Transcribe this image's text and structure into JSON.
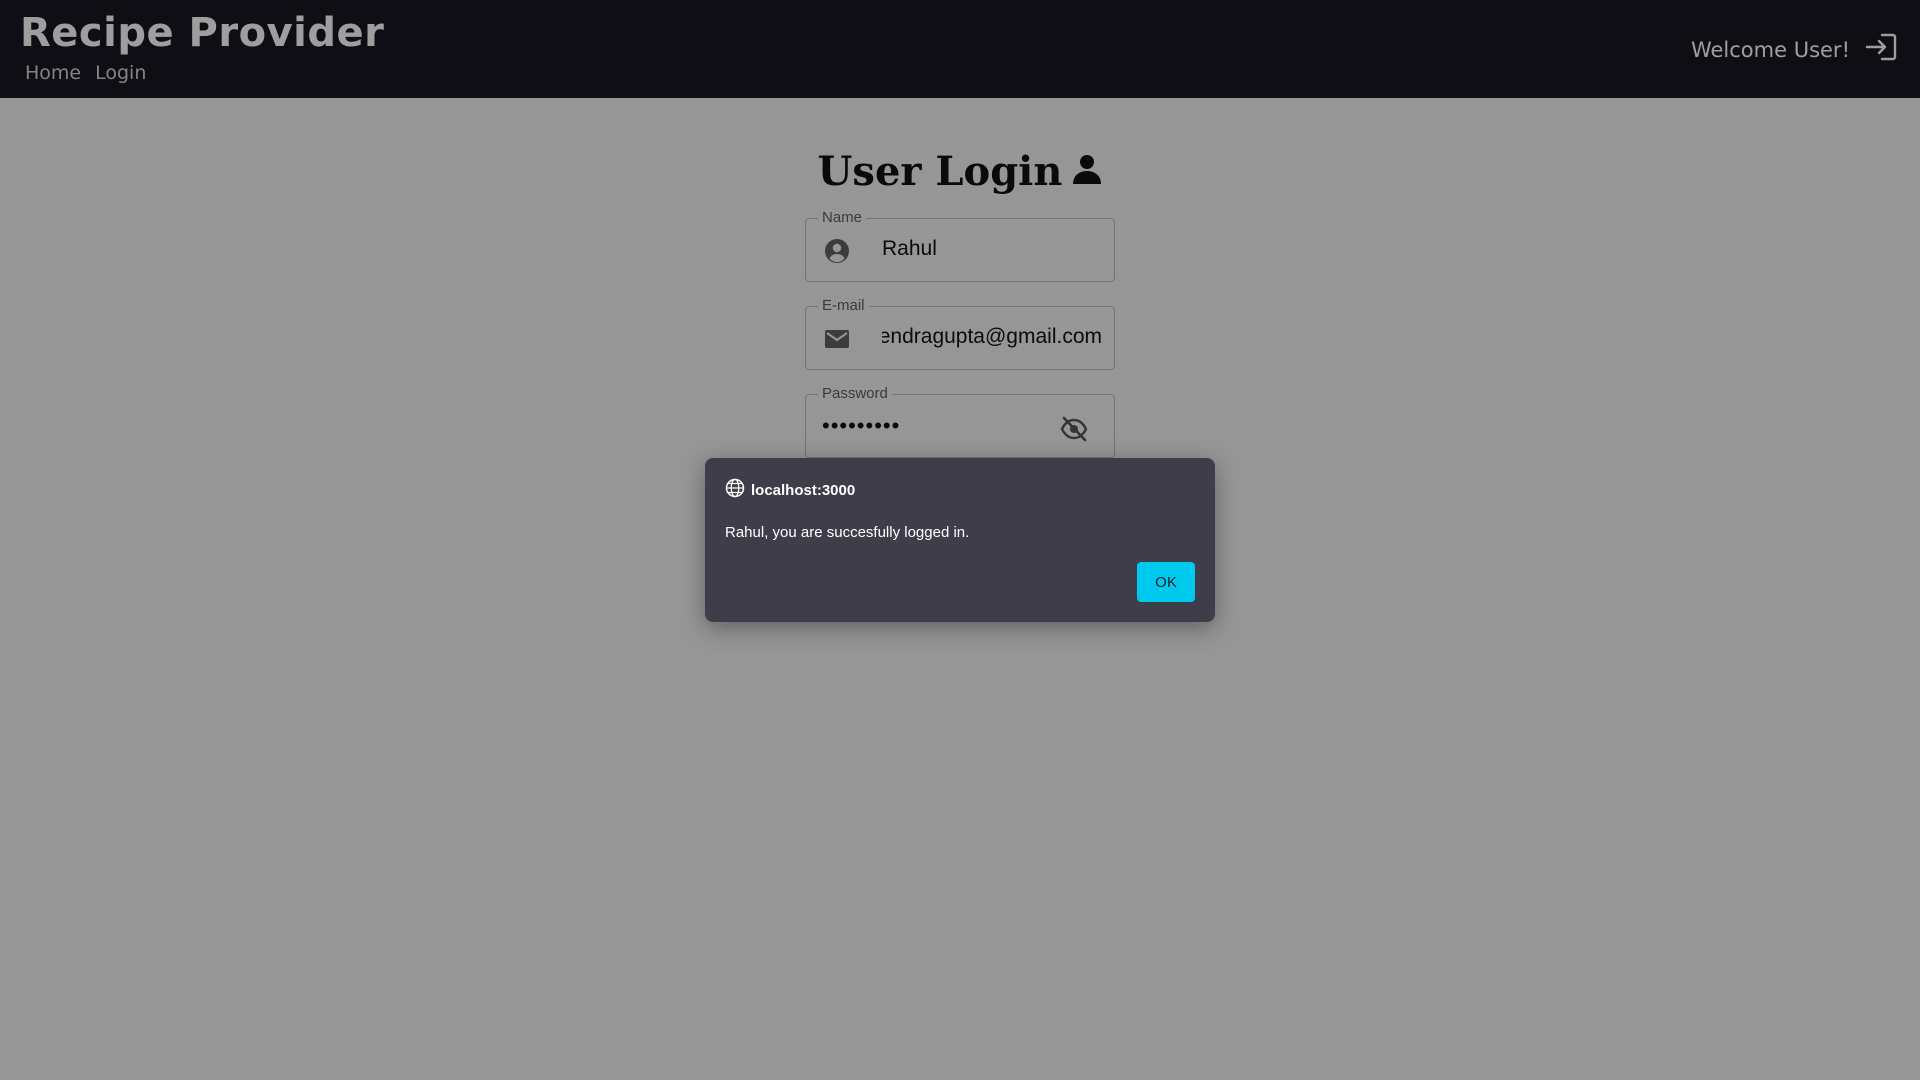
{
  "header": {
    "brand": "Recipe Provider",
    "nav": [
      "Home",
      "Login"
    ],
    "welcome": "Welcome User!"
  },
  "login": {
    "title": "User Login",
    "fields": {
      "name": {
        "label": "Name",
        "value": "Rahul"
      },
      "email": {
        "label": "E-mail",
        "value": "rajendragupta@gmail.com"
      },
      "password": {
        "label": "Password",
        "value": "•••••••••"
      }
    }
  },
  "dialog": {
    "origin": "localhost:3000",
    "message": "Rahul, you are succesfully logged in.",
    "ok_label": "OK"
  },
  "colors": {
    "header_bg": "#181821",
    "page_bg": "#f2f2f2",
    "dialog_bg": "#3f3d4a",
    "accent": "#00c9ee"
  },
  "icons": {
    "login": "login-arrow-icon",
    "user": "person-icon",
    "name_field": "account-circle-icon",
    "email_field": "mail-icon",
    "password_toggle": "eye-off-icon",
    "dialog_origin": "globe-icon"
  }
}
